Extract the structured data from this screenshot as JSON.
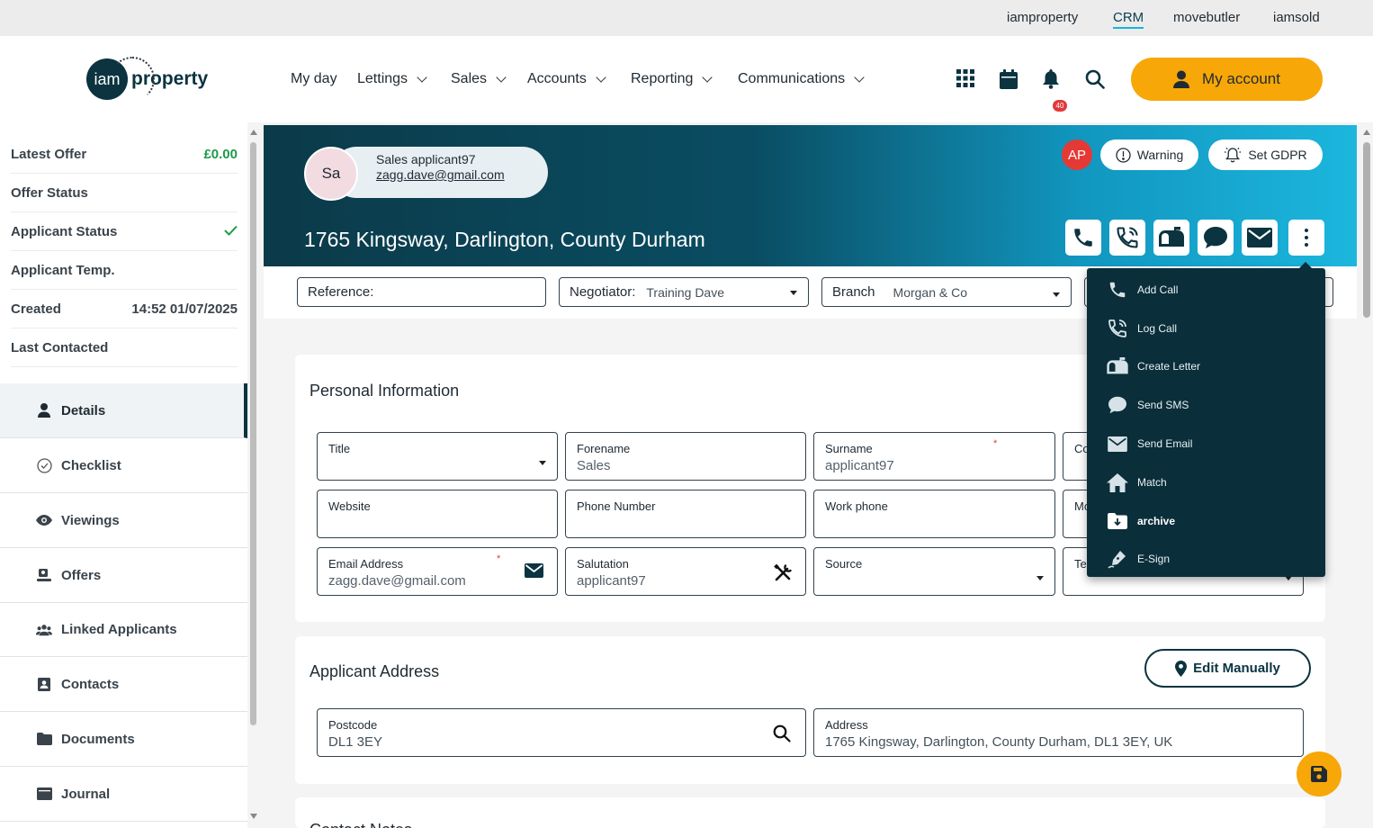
{
  "top_links": [
    "iamproperty",
    "CRM",
    "movebutler",
    "iamsold"
  ],
  "logo": {
    "mark": "iam",
    "text": "property"
  },
  "nav": {
    "my_day": "My day",
    "lettings": "Lettings",
    "sales": "Sales",
    "accounts": "Accounts",
    "reporting": "Reporting",
    "communications": "Communications"
  },
  "header": {
    "notification_count": "40",
    "my_account": "My account"
  },
  "sidebar": {
    "summary": [
      {
        "label": "Latest Offer",
        "value": "£0.00"
      },
      {
        "label": "Offer Status",
        "value": ""
      },
      {
        "label": "Applicant Status",
        "value": ""
      },
      {
        "label": "Applicant Temp.",
        "value": ""
      },
      {
        "label": "Created",
        "value": "14:52 01/07/2025"
      },
      {
        "label": "Last Contacted",
        "value": ""
      }
    ],
    "nav": [
      "Details",
      "Checklist",
      "Viewings",
      "Offers",
      "Linked Applicants",
      "Contacts",
      "Documents",
      "Journal"
    ]
  },
  "banner": {
    "initials": "Sa",
    "name": "Sales applicant97",
    "email": "zagg.dave@gmail.com",
    "address": "1765 Kingsway, Darlington, County Durham",
    "user_badge": "AP",
    "warning": "Warning",
    "gdpr": "Set GDPR"
  },
  "filters": {
    "reference_label": "Reference:",
    "negotiator_label": "Negotiator:",
    "negotiator_value": "Training Dave",
    "branch_label": "Branch",
    "branch_value": "Morgan & Co"
  },
  "personal": {
    "title": "Personal Information",
    "fields": {
      "title_label": "Title",
      "forename_label": "Forename",
      "forename_value": "Sales",
      "surname_label": "Surname",
      "surname_value": "applicant97",
      "col4_row1": "Co",
      "website_label": "Website",
      "phone_label": "Phone Number",
      "work_label": "Work phone",
      "col4_row2": "Mo",
      "email_label": "Email Address",
      "email_value": "zagg.dave@gmail.com",
      "salutation_label": "Salutation",
      "salutation_value": "applicant97",
      "source_label": "Source",
      "col4_row3": "Te"
    },
    "required_mark": "*"
  },
  "address_card": {
    "title": "Applicant Address",
    "edit_button": "Edit Manually",
    "postcode_label": "Postcode",
    "postcode_value": "DL1 3EY",
    "address_label": "Address",
    "address_value": "1765 Kingsway, Darlington, County Durham, DL1 3EY, UK"
  },
  "next_card_title": "Contact Notes",
  "dropdown": [
    "Add Call",
    "Log Call",
    "Create Letter",
    "Send SMS",
    "Send Email",
    "Match",
    "archive",
    "E-Sign"
  ],
  "colors": {
    "accent": "#f7a707",
    "dark": "#0b3340",
    "banner_end": "#1cb6dd",
    "dropdown_bg": "#0a2e3a"
  }
}
